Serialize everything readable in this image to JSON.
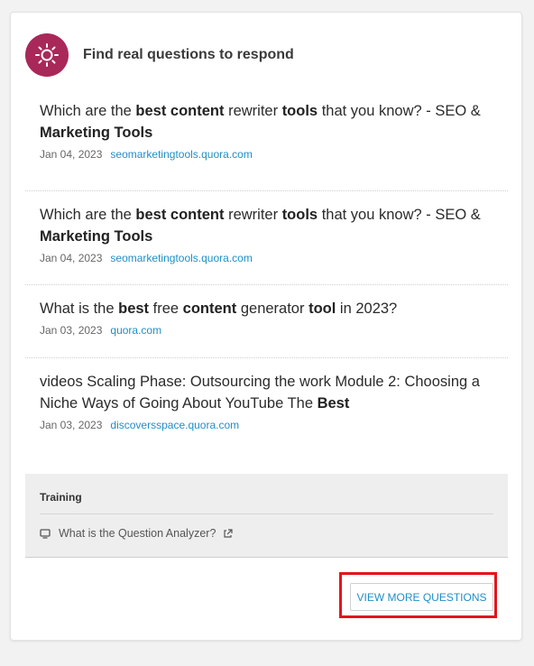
{
  "header": {
    "title": "Find real questions to respond",
    "icon": "sun-icon",
    "icon_color": "#a8285a"
  },
  "questions": [
    {
      "segments": [
        {
          "t": "Which are the ",
          "b": false
        },
        {
          "t": "best",
          "b": true
        },
        {
          "t": " ",
          "b": false
        },
        {
          "t": "content",
          "b": true
        },
        {
          "t": " rewriter ",
          "b": false
        },
        {
          "t": "tools",
          "b": true
        },
        {
          "t": " that you know? - SEO & ",
          "b": false
        },
        {
          "t": "Marketing",
          "b": true
        },
        {
          "t": " ",
          "b": false
        },
        {
          "t": "Tools",
          "b": true
        }
      ],
      "date": "Jan 04, 2023",
      "source": "seomarketingtools.quora.com"
    },
    {
      "segments": [
        {
          "t": "Which are the ",
          "b": false
        },
        {
          "t": "best",
          "b": true
        },
        {
          "t": " ",
          "b": false
        },
        {
          "t": "content",
          "b": true
        },
        {
          "t": " rewriter ",
          "b": false
        },
        {
          "t": "tools",
          "b": true
        },
        {
          "t": " that you know? - SEO & ",
          "b": false
        },
        {
          "t": "Marketing",
          "b": true
        },
        {
          "t": " ",
          "b": false
        },
        {
          "t": "Tools",
          "b": true
        }
      ],
      "date": "Jan 04, 2023",
      "source": "seomarketingtools.quora.com"
    },
    {
      "segments": [
        {
          "t": "What is the ",
          "b": false
        },
        {
          "t": "best",
          "b": true
        },
        {
          "t": " free ",
          "b": false
        },
        {
          "t": "content",
          "b": true
        },
        {
          "t": " generator ",
          "b": false
        },
        {
          "t": "tool",
          "b": true
        },
        {
          "t": " in 2023?",
          "b": false
        }
      ],
      "date": "Jan 03, 2023",
      "source": "quora.com"
    },
    {
      "segments": [
        {
          "t": "videos Scaling Phase: Outsourcing the work Module 2: Choosing a Niche Ways of Going About YouTube The ",
          "b": false
        },
        {
          "t": "Best",
          "b": true
        }
      ],
      "date": "Jan 03, 2023",
      "source": "discoversspace.quora.com"
    }
  ],
  "training": {
    "title": "Training",
    "link_label": "What is the Question Analyzer?",
    "link_icon": "monitor-icon",
    "external_icon": "external-link-icon"
  },
  "actions": {
    "view_more_label": "VIEW MORE QUESTIONS"
  },
  "colors": {
    "link": "#1f8fc7",
    "highlight": "#e5141c"
  }
}
